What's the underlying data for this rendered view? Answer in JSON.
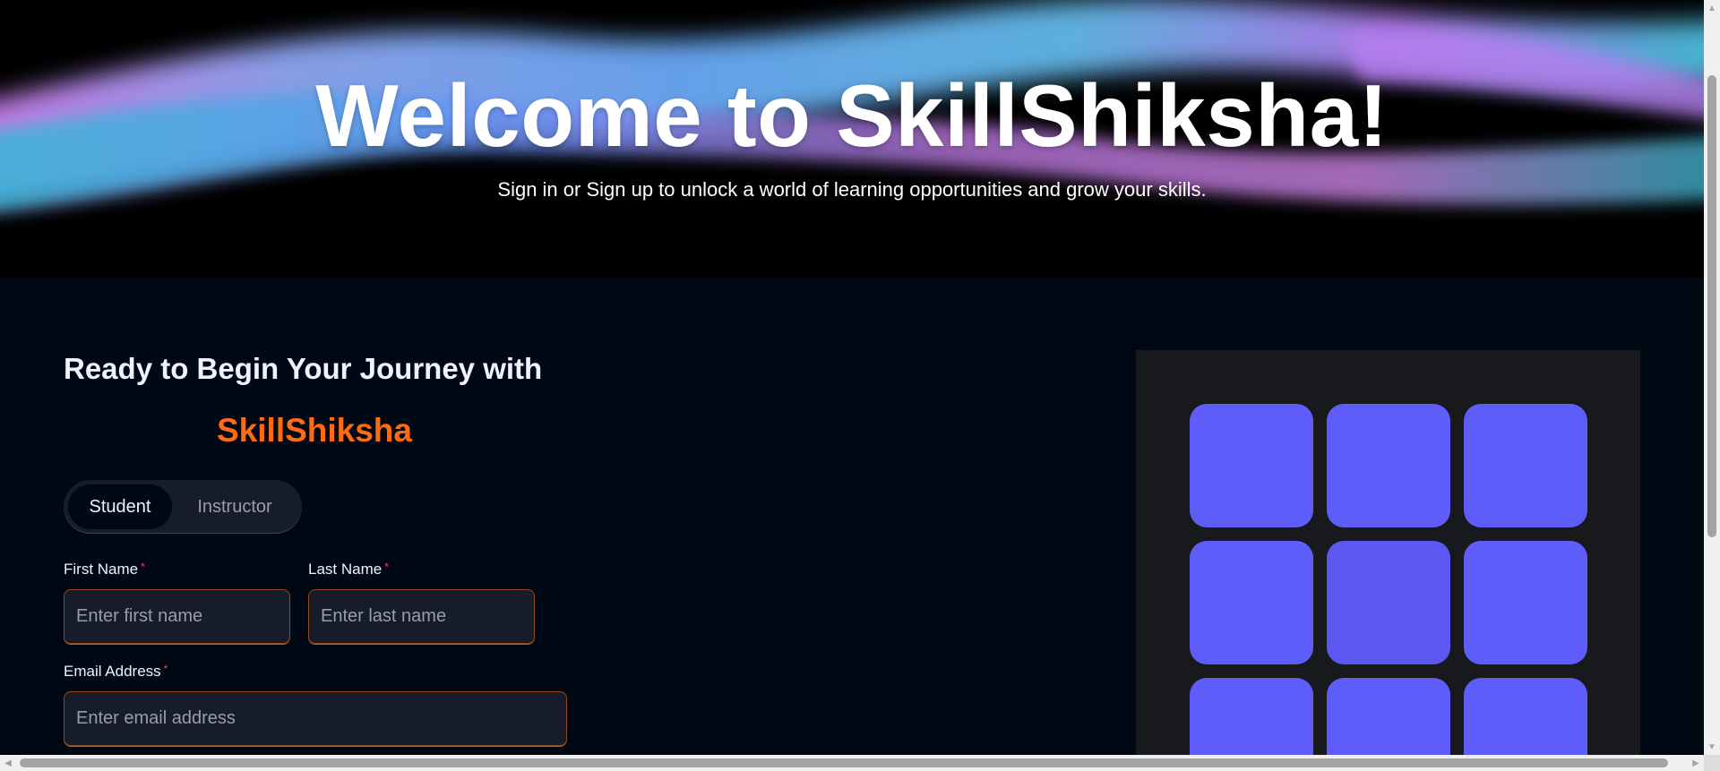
{
  "hero": {
    "title": "Welcome to SkillShiksha!",
    "subtitle": "Sign in or Sign up to unlock a world of learning opportunities and grow your skills."
  },
  "signup": {
    "heading": "Ready to Begin Your Journey with",
    "brand": "SkillShiksha",
    "roles": [
      "Student",
      "Instructor"
    ],
    "selected_role": "Student",
    "required_mark": "*",
    "first_name": {
      "label": "First Name",
      "placeholder": "Enter first name",
      "value": ""
    },
    "last_name": {
      "label": "Last Name",
      "placeholder": "Enter last name",
      "value": ""
    },
    "email": {
      "label": "Email Address",
      "placeholder": "Enter email address",
      "value": ""
    }
  },
  "theme": {
    "background": "#000814",
    "hero_background": "#000000",
    "brand_color": "#FF6A13",
    "input_background": "#161D29",
    "tile_color": "#5F5DF9",
    "panel_background": "#17191D"
  },
  "visual": {
    "tile_count": 9
  }
}
